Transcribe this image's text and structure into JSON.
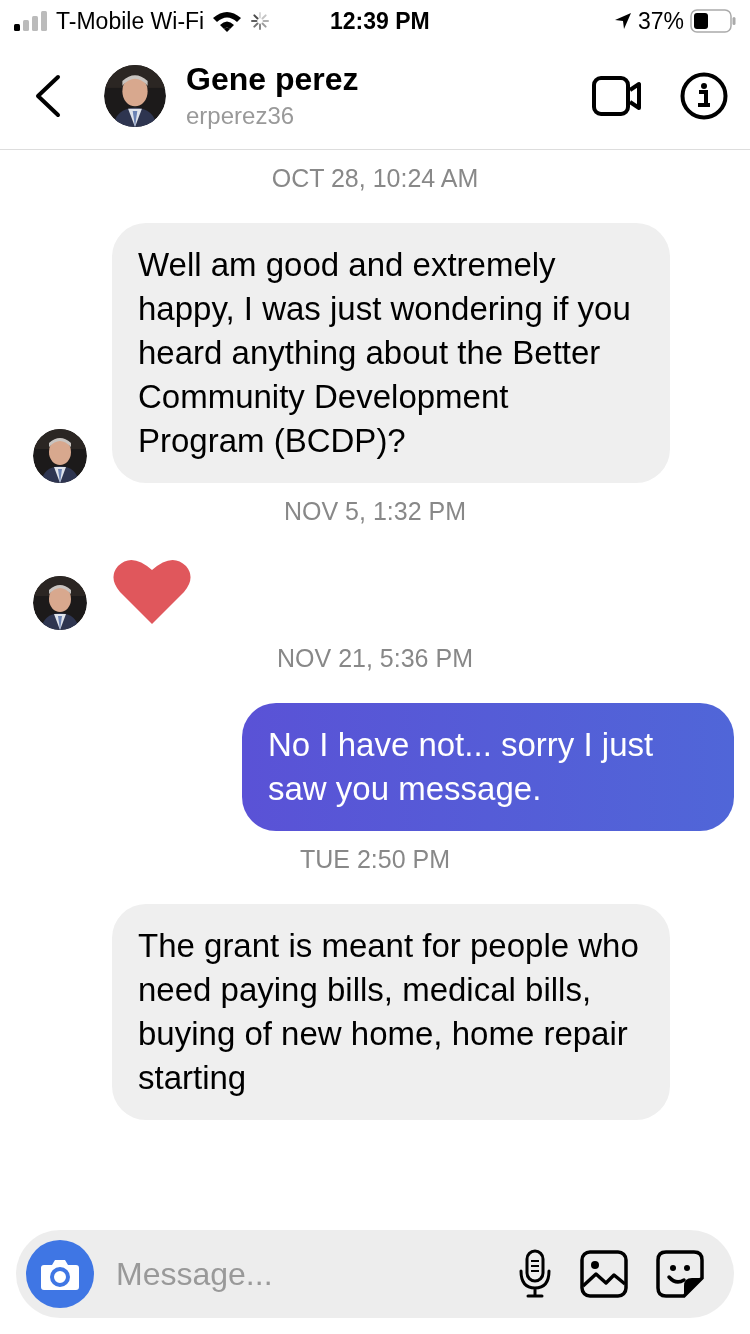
{
  "status_bar": {
    "carrier": "T-Mobile Wi-Fi",
    "time": "12:39 PM",
    "battery": "37%"
  },
  "header": {
    "name": "Gene perez",
    "username": "erperez36"
  },
  "messages": [
    {
      "kind": "timestamp",
      "text": "OCT 28, 10:24 AM"
    },
    {
      "kind": "incoming",
      "avatar": true,
      "text": "Well am good and extremely happy, I was just wondering if you heard anything about  the Better Community Development Program (BCDP)?"
    },
    {
      "kind": "timestamp",
      "text": "NOV 5, 1:32 PM"
    },
    {
      "kind": "heart",
      "avatar": true
    },
    {
      "kind": "timestamp",
      "text": "NOV 21, 5:36 PM"
    },
    {
      "kind": "outgoing",
      "avatar": false,
      "text": "No I have not... sorry I just saw you message."
    },
    {
      "kind": "timestamp",
      "text": "TUE 2:50 PM"
    },
    {
      "kind": "incoming",
      "avatar": false,
      "text": "The grant is meant for people who need paying bills, medical bills, buying of new home, home repair starting"
    }
  ],
  "composer": {
    "placeholder": "Message..."
  }
}
